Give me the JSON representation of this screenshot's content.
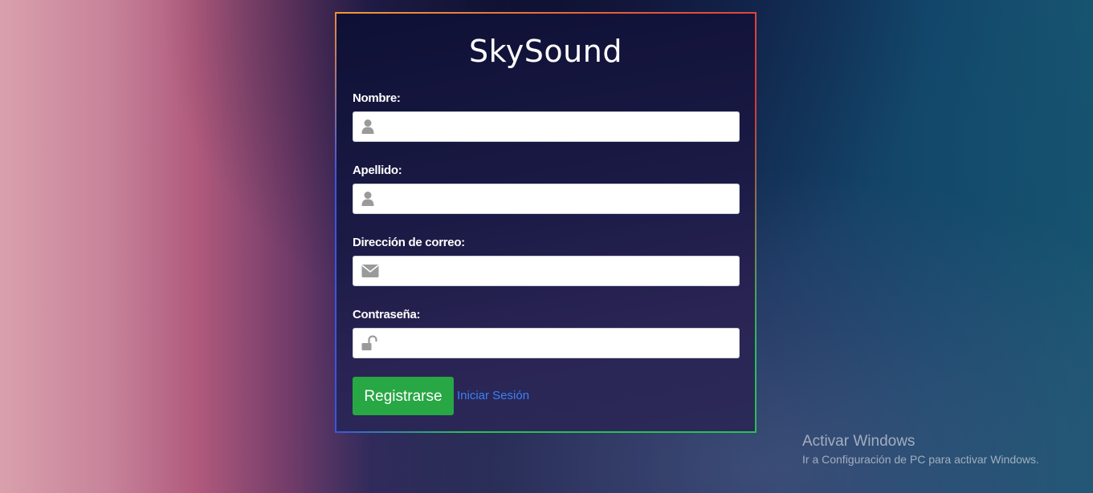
{
  "app": {
    "title": "SkySound"
  },
  "form": {
    "fields": [
      {
        "label": "Nombre:",
        "value": "",
        "placeholder": "",
        "icon": "user-icon"
      },
      {
        "label": "Apellido:",
        "value": "",
        "placeholder": "",
        "icon": "user-icon"
      },
      {
        "label": "Dirección de correo:",
        "value": "",
        "placeholder": "",
        "icon": "envelope-icon"
      },
      {
        "label": "Contraseña:",
        "value": "",
        "placeholder": "",
        "icon": "unlock-icon"
      }
    ],
    "submit_label": "Registrarse",
    "login_link_label": "Iniciar Sesión"
  },
  "watermark": {
    "title": "Activar Windows",
    "subtitle": "Ir a Configuración de PC para activar Windows."
  },
  "colors": {
    "submit_button": "#28a745",
    "link": "#3b82f6",
    "icon": "#9a9a9a"
  }
}
